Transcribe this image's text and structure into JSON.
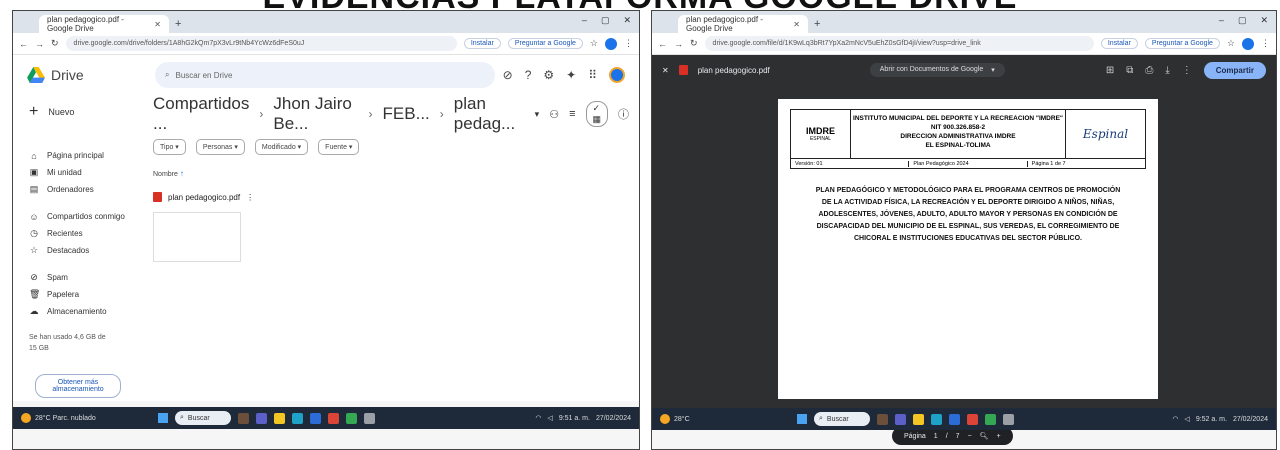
{
  "heading": "EVIDENCIAS PLATAFORMA GOOGLE DRIVE",
  "left": {
    "browser": {
      "tab_title": "plan pedagogico.pdf - Google Drive",
      "url": "drive.google.com/drive/folders/1A8hG2kQm7pX3vLr9tNb4YcWz6dFeS0uJ",
      "chip_install": "Instalar",
      "chip_ask": "Preguntar a Google"
    },
    "drive": {
      "logo_text": "Drive",
      "search_placeholder": "Buscar en Drive",
      "new_label": "Nuevo",
      "nav": [
        {
          "icon": "⌂",
          "label": "Página principal"
        },
        {
          "icon": "▣",
          "label": "Mi unidad"
        },
        {
          "icon": "▤",
          "label": "Ordenadores"
        },
        {
          "icon": "☺",
          "label": "Compartidos conmigo"
        },
        {
          "icon": "◷",
          "label": "Recientes"
        },
        {
          "icon": "☆",
          "label": "Destacados"
        },
        {
          "icon": "⊘",
          "label": "Spam"
        },
        {
          "icon": "🗑",
          "label": "Papelera"
        },
        {
          "icon": "☁",
          "label": "Almacenamiento"
        }
      ],
      "storage_text": "Se han usado 4,6 GB de 15 GB",
      "get_more": "Obtener más almacenamiento",
      "breadcrumbs": [
        "Compartidos ...",
        "Jhon Jairo Be...",
        "FEB...",
        "plan pedag..."
      ],
      "filters": [
        "Tipo ▾",
        "Personas ▾",
        "Modificado ▾",
        "Fuente ▾"
      ],
      "sort_label": "Nombre",
      "file_name": "plan pedagogico.pdf"
    },
    "taskbar": {
      "weather": "28°C Parc. nublado",
      "search": "Buscar",
      "clock_time": "9:51 a. m.",
      "clock_date": "27/02/2024"
    }
  },
  "right": {
    "browser": {
      "tab_title": "plan pedagogico.pdf - Google Drive",
      "url": "drive.google.com/file/d/1K9wLq3bRt7YpXa2mNcV5uEhZ0sGfD4jI/view?usp=drive_link",
      "chip_install": "Instalar",
      "chip_ask": "Preguntar a Google"
    },
    "viewer": {
      "file_name": "plan pedagogico.pdf",
      "open_with": "Abrir con Documentos de Google",
      "share": "Compartir",
      "pagebar_label": "Página",
      "page_current": "1",
      "page_sep": "/",
      "page_total": "7"
    },
    "document": {
      "logo_text": "IMDRE",
      "logo_sub": "ESPINAL",
      "header_lines": [
        "INSTITUTO MUNICIPAL DEL DEPORTE Y LA RECREACION \"IMDRE\"",
        "NIT 900.326.858-2",
        "DIRECCION ADMINISTRATIVA IMDRE",
        "EL ESPINAL-TOLIMA"
      ],
      "right_logo": "Espinal",
      "sub_cells": [
        "Versión: 01",
        "Plan Pedagógico 2024",
        "Página 1 de 7"
      ],
      "body": "PLAN PEDAGÓGICO Y METODOLÓGICO PARA EL PROGRAMA CENTROS DE PROMOCIÓN DE LA ACTIVIDAD FÍSICA, LA RECREACIÓN Y EL DEPORTE DIRIGIDO A NIÑOS, NIÑAS, ADOLESCENTES, JÓVENES, ADULTO, ADULTO MAYOR Y PERSONAS EN CONDICIÓN DE DISCAPACIDAD DEL MUNICIPIO DE EL ESPINAL, SUS VEREDAS, EL CORREGIMIENTO DE CHICORAL E INSTITUCIONES EDUCATIVAS DEL SECTOR PÚBLICO."
    },
    "taskbar": {
      "weather": "28°C",
      "search": "Buscar",
      "clock_time": "9:52 a. m.",
      "clock_date": "27/02/2024"
    }
  }
}
